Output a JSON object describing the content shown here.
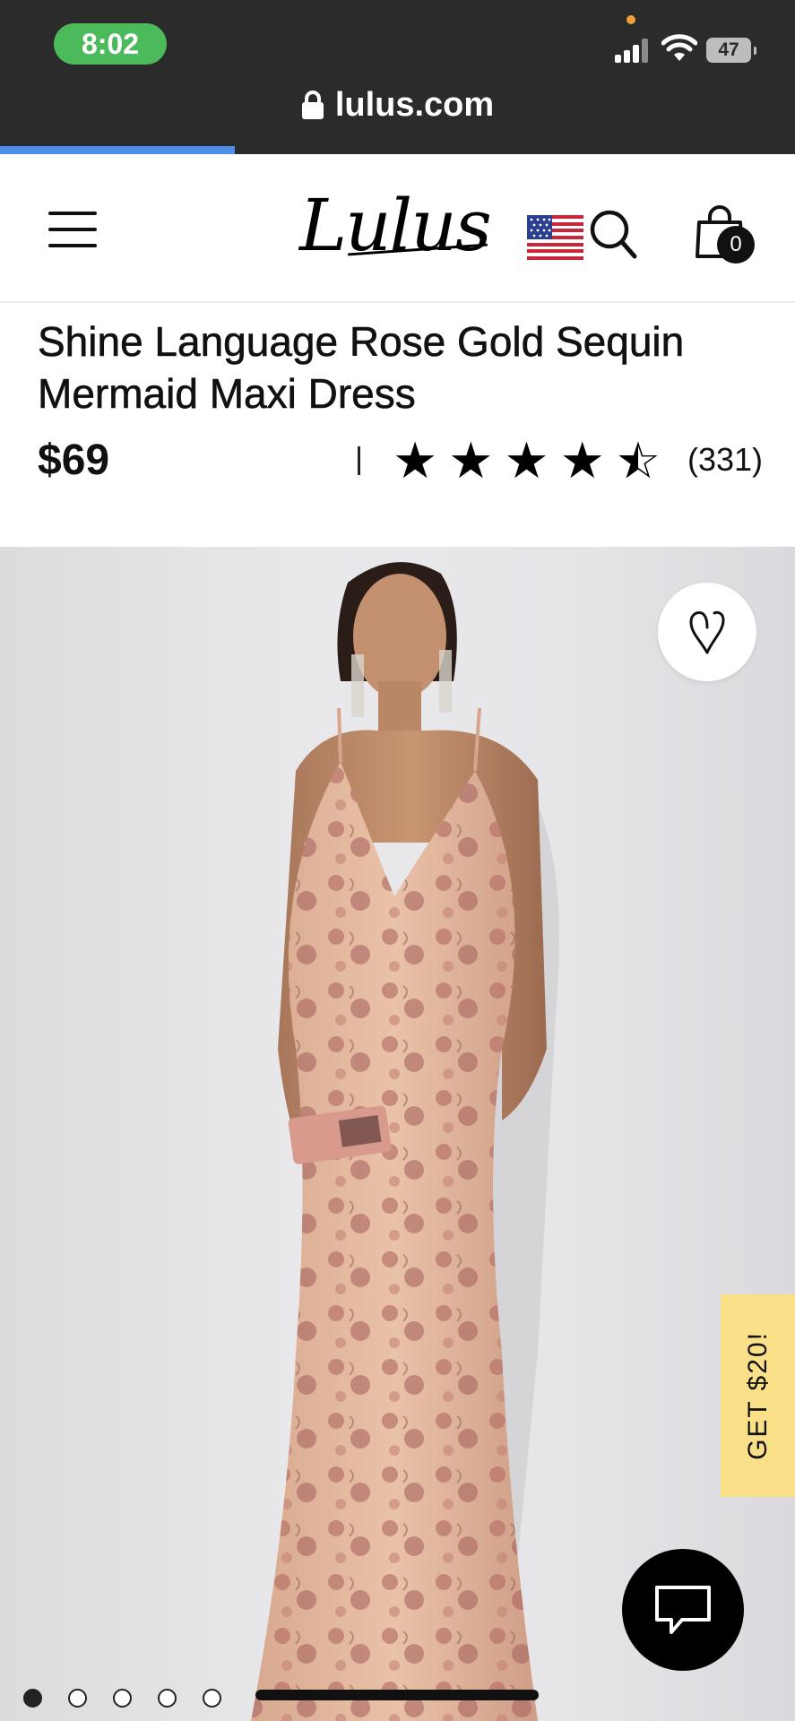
{
  "status_bar": {
    "time": "8:02",
    "battery": "47"
  },
  "browser": {
    "url": "lulus.com",
    "load_progress": 0.295
  },
  "header": {
    "logo_text": "Lulus",
    "menu_icon": "hamburger-icon",
    "flag_icon": "us-flag-icon",
    "search_icon": "search-icon",
    "bag_icon": "shopping-bag-icon",
    "bag_count": "0"
  },
  "product": {
    "title": "Shine Language Rose Gold Sequin Mermaid Maxi Dress",
    "price": "$69",
    "rating": 4.5,
    "rating_max": 5,
    "review_count": "(331)"
  },
  "gallery": {
    "image_count": 5,
    "active_index": 0,
    "wishlist_icon": "heart-icon",
    "chat_icon": "chat-bubble-icon"
  },
  "promo": {
    "label": "GET $20!",
    "color": "#f9e089"
  },
  "colors": {
    "status_green": "#4cba5b",
    "progress_blue": "#4d8fe8",
    "chrome_dark": "#2b2b2b"
  }
}
